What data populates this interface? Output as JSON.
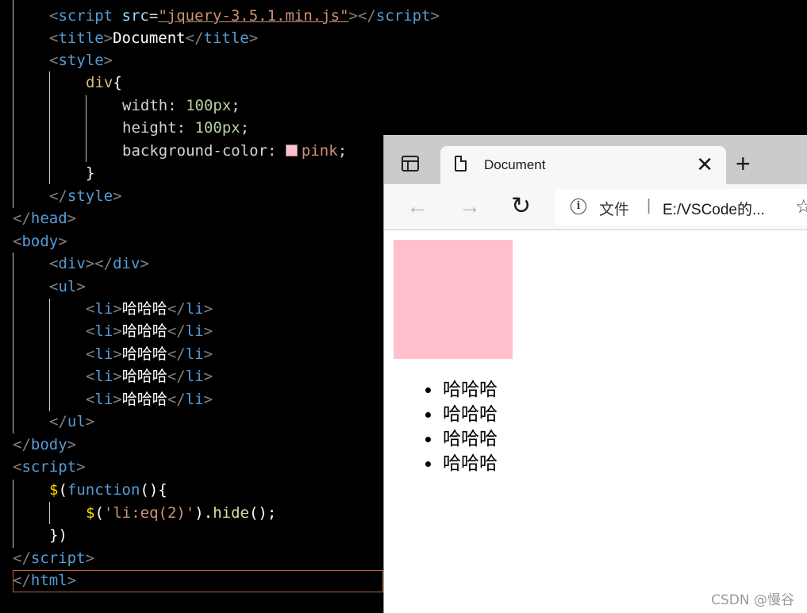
{
  "editor": {
    "lines": [
      {
        "tokens": [
          [
            "tg",
            "<"
          ],
          [
            "tn",
            "script"
          ],
          [
            "at",
            " src"
          ],
          [
            "pr",
            "="
          ],
          [
            "st",
            "\"jquery-3.5.1.min.js\""
          ],
          [
            "tg",
            "></"
          ],
          [
            "tn",
            "script"
          ],
          [
            "tg",
            ">"
          ]
        ],
        "indent": 1
      },
      {
        "tokens": [
          [
            "tg",
            "<"
          ],
          [
            "tn",
            "title"
          ],
          [
            "tg",
            ">"
          ],
          [
            "tx",
            "Document"
          ],
          [
            "tg",
            "</"
          ],
          [
            "tn",
            "title"
          ],
          [
            "tg",
            ">"
          ]
        ],
        "indent": 1
      },
      {
        "tokens": [
          [
            "tg",
            "<"
          ],
          [
            "tn",
            "style"
          ],
          [
            "tg",
            ">"
          ]
        ],
        "indent": 1
      },
      {
        "tokens": [
          [
            "sel",
            "div"
          ],
          [
            "wh",
            "{"
          ]
        ],
        "indent": 2
      },
      {
        "tokens": [
          [
            "pr",
            "width"
          ],
          [
            "pr",
            ": "
          ],
          [
            "nu",
            "100px"
          ],
          [
            "pr",
            ";"
          ]
        ],
        "indent": 3
      },
      {
        "tokens": [
          [
            "pr",
            "height"
          ],
          [
            "pr",
            ": "
          ],
          [
            "nu",
            "100px"
          ],
          [
            "pr",
            ";"
          ]
        ],
        "indent": 3
      },
      {
        "tokens": [
          [
            "pr",
            "background-color"
          ],
          [
            "pr",
            ": "
          ],
          [
            "sw",
            ""
          ],
          [
            "st",
            "pink"
          ],
          [
            "pr",
            ";"
          ]
        ],
        "indent": 3
      },
      {
        "tokens": [
          [
            "wh",
            "}"
          ]
        ],
        "indent": 2
      },
      {
        "tokens": [
          [
            "tg",
            "</"
          ],
          [
            "tn",
            "style"
          ],
          [
            "tg",
            ">"
          ]
        ],
        "indent": 1
      },
      {
        "tokens": [
          [
            "tg",
            "</"
          ],
          [
            "tn",
            "head"
          ],
          [
            "tg",
            ">"
          ]
        ],
        "indent": 0
      },
      {
        "tokens": [
          [
            "tg",
            "<"
          ],
          [
            "tn",
            "body"
          ],
          [
            "tg",
            ">"
          ]
        ],
        "indent": 0
      },
      {
        "tokens": [
          [
            "tg",
            "<"
          ],
          [
            "tn",
            "div"
          ],
          [
            "tg",
            "></"
          ],
          [
            "tn",
            "div"
          ],
          [
            "tg",
            ">"
          ]
        ],
        "indent": 1
      },
      {
        "tokens": [
          [
            "tg",
            "<"
          ],
          [
            "tn",
            "ul"
          ],
          [
            "tg",
            ">"
          ]
        ],
        "indent": 1
      },
      {
        "tokens": [
          [
            "tg",
            "<"
          ],
          [
            "tn",
            "li"
          ],
          [
            "tg",
            ">"
          ],
          [
            "tx",
            "哈哈哈"
          ],
          [
            "tg",
            "</"
          ],
          [
            "tn",
            "li"
          ],
          [
            "tg",
            ">"
          ]
        ],
        "indent": 2
      },
      {
        "tokens": [
          [
            "tg",
            "<"
          ],
          [
            "tn",
            "li"
          ],
          [
            "tg",
            ">"
          ],
          [
            "tx",
            "哈哈哈"
          ],
          [
            "tg",
            "</"
          ],
          [
            "tn",
            "li"
          ],
          [
            "tg",
            ">"
          ]
        ],
        "indent": 2
      },
      {
        "tokens": [
          [
            "tg",
            "<"
          ],
          [
            "tn",
            "li"
          ],
          [
            "tg",
            ">"
          ],
          [
            "tx",
            "哈哈哈"
          ],
          [
            "tg",
            "</"
          ],
          [
            "tn",
            "li"
          ],
          [
            "tg",
            ">"
          ]
        ],
        "indent": 2
      },
      {
        "tokens": [
          [
            "tg",
            "<"
          ],
          [
            "tn",
            "li"
          ],
          [
            "tg",
            ">"
          ],
          [
            "tx",
            "哈哈哈"
          ],
          [
            "tg",
            "</"
          ],
          [
            "tn",
            "li"
          ],
          [
            "tg",
            ">"
          ]
        ],
        "indent": 2
      },
      {
        "tokens": [
          [
            "tg",
            "<"
          ],
          [
            "tn",
            "li"
          ],
          [
            "tg",
            ">"
          ],
          [
            "tx",
            "哈哈哈"
          ],
          [
            "tg",
            "</"
          ],
          [
            "tn",
            "li"
          ],
          [
            "tg",
            ">"
          ]
        ],
        "indent": 2
      },
      {
        "tokens": [
          [
            "tg",
            "</"
          ],
          [
            "tn",
            "ul"
          ],
          [
            "tg",
            ">"
          ]
        ],
        "indent": 1
      },
      {
        "tokens": [
          [
            "tg",
            "</"
          ],
          [
            "tn",
            "body"
          ],
          [
            "tg",
            ">"
          ]
        ],
        "indent": 0
      },
      {
        "tokens": [
          [
            "tg",
            "<"
          ],
          [
            "tn",
            "script"
          ],
          [
            "tg",
            ">"
          ]
        ],
        "indent": 0
      },
      {
        "tokens": [
          [
            "br",
            "$"
          ],
          [
            "wh",
            "("
          ],
          [
            "kw",
            "function"
          ],
          [
            "wh",
            "(){"
          ]
        ],
        "indent": 1
      },
      {
        "tokens": [
          [
            "br",
            "$"
          ],
          [
            "wh",
            "("
          ],
          [
            "st",
            "'li:eq(2)'"
          ],
          [
            "wh",
            ")."
          ],
          [
            "fn",
            "hide"
          ],
          [
            "wh",
            "();"
          ]
        ],
        "indent": 2
      },
      {
        "tokens": [
          [
            "wh",
            "})"
          ]
        ],
        "indent": 1
      },
      {
        "tokens": [
          [
            "tg",
            "</"
          ],
          [
            "tn",
            "script"
          ],
          [
            "tg",
            ">"
          ]
        ],
        "indent": 0
      },
      {
        "tokens": [
          [
            "tg",
            "</"
          ],
          [
            "tn",
            "html"
          ],
          [
            "tg",
            ">"
          ]
        ],
        "indent": 0
      }
    ]
  },
  "browser": {
    "tab_title": "Document",
    "close_glyph": "✕",
    "new_tab_glyph": "+",
    "back_glyph": "←",
    "forward_glyph": "→",
    "reload_glyph": "↻",
    "address_label": "文件",
    "address_sep": "|",
    "address_url": "E:/VSCode的...",
    "favorite_glyph": "☆",
    "info_glyph": "i",
    "list_items": [
      "哈哈哈",
      "哈哈哈",
      "哈哈哈",
      "哈哈哈"
    ],
    "box_color": "#ffc0cb"
  },
  "watermark": "CSDN @慢谷"
}
